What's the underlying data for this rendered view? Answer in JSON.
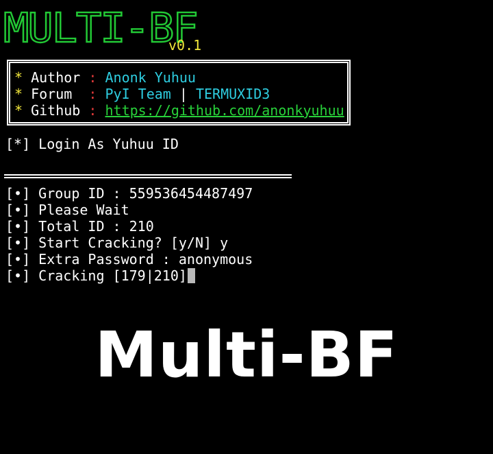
{
  "banner": {
    "logo_text": "MULTI-BF",
    "version": "v0.1"
  },
  "info": {
    "author_label": "Author",
    "author_value": "Anonk Yuhuu",
    "forum_label": "Forum",
    "forum_team": "PyI Team",
    "forum_pipe": "|",
    "forum_group": "TERMUXID3",
    "github_label": "Github",
    "github_value": "https://github.com/anonkyuhuu",
    "star": "*",
    "colon": ":"
  },
  "login_line": "[*] Login As Yuhuu ID",
  "log_lines": [
    "[•] Group ID : 559536454487497",
    "[•] Please Wait",
    "[•] Total ID : 210",
    "[•] Start Cracking? [y/N] y",
    "[•] Extra Password : anonymous",
    "[•] Cracking [179|210]"
  ],
  "overlay_title": "Multi-BF",
  "colors": {
    "background": "#000000",
    "banner_green": "#22c935",
    "yellow": "#f1e63b",
    "red": "#e33a3a",
    "cyan": "#2ecde0",
    "link_green": "#28d13a"
  }
}
